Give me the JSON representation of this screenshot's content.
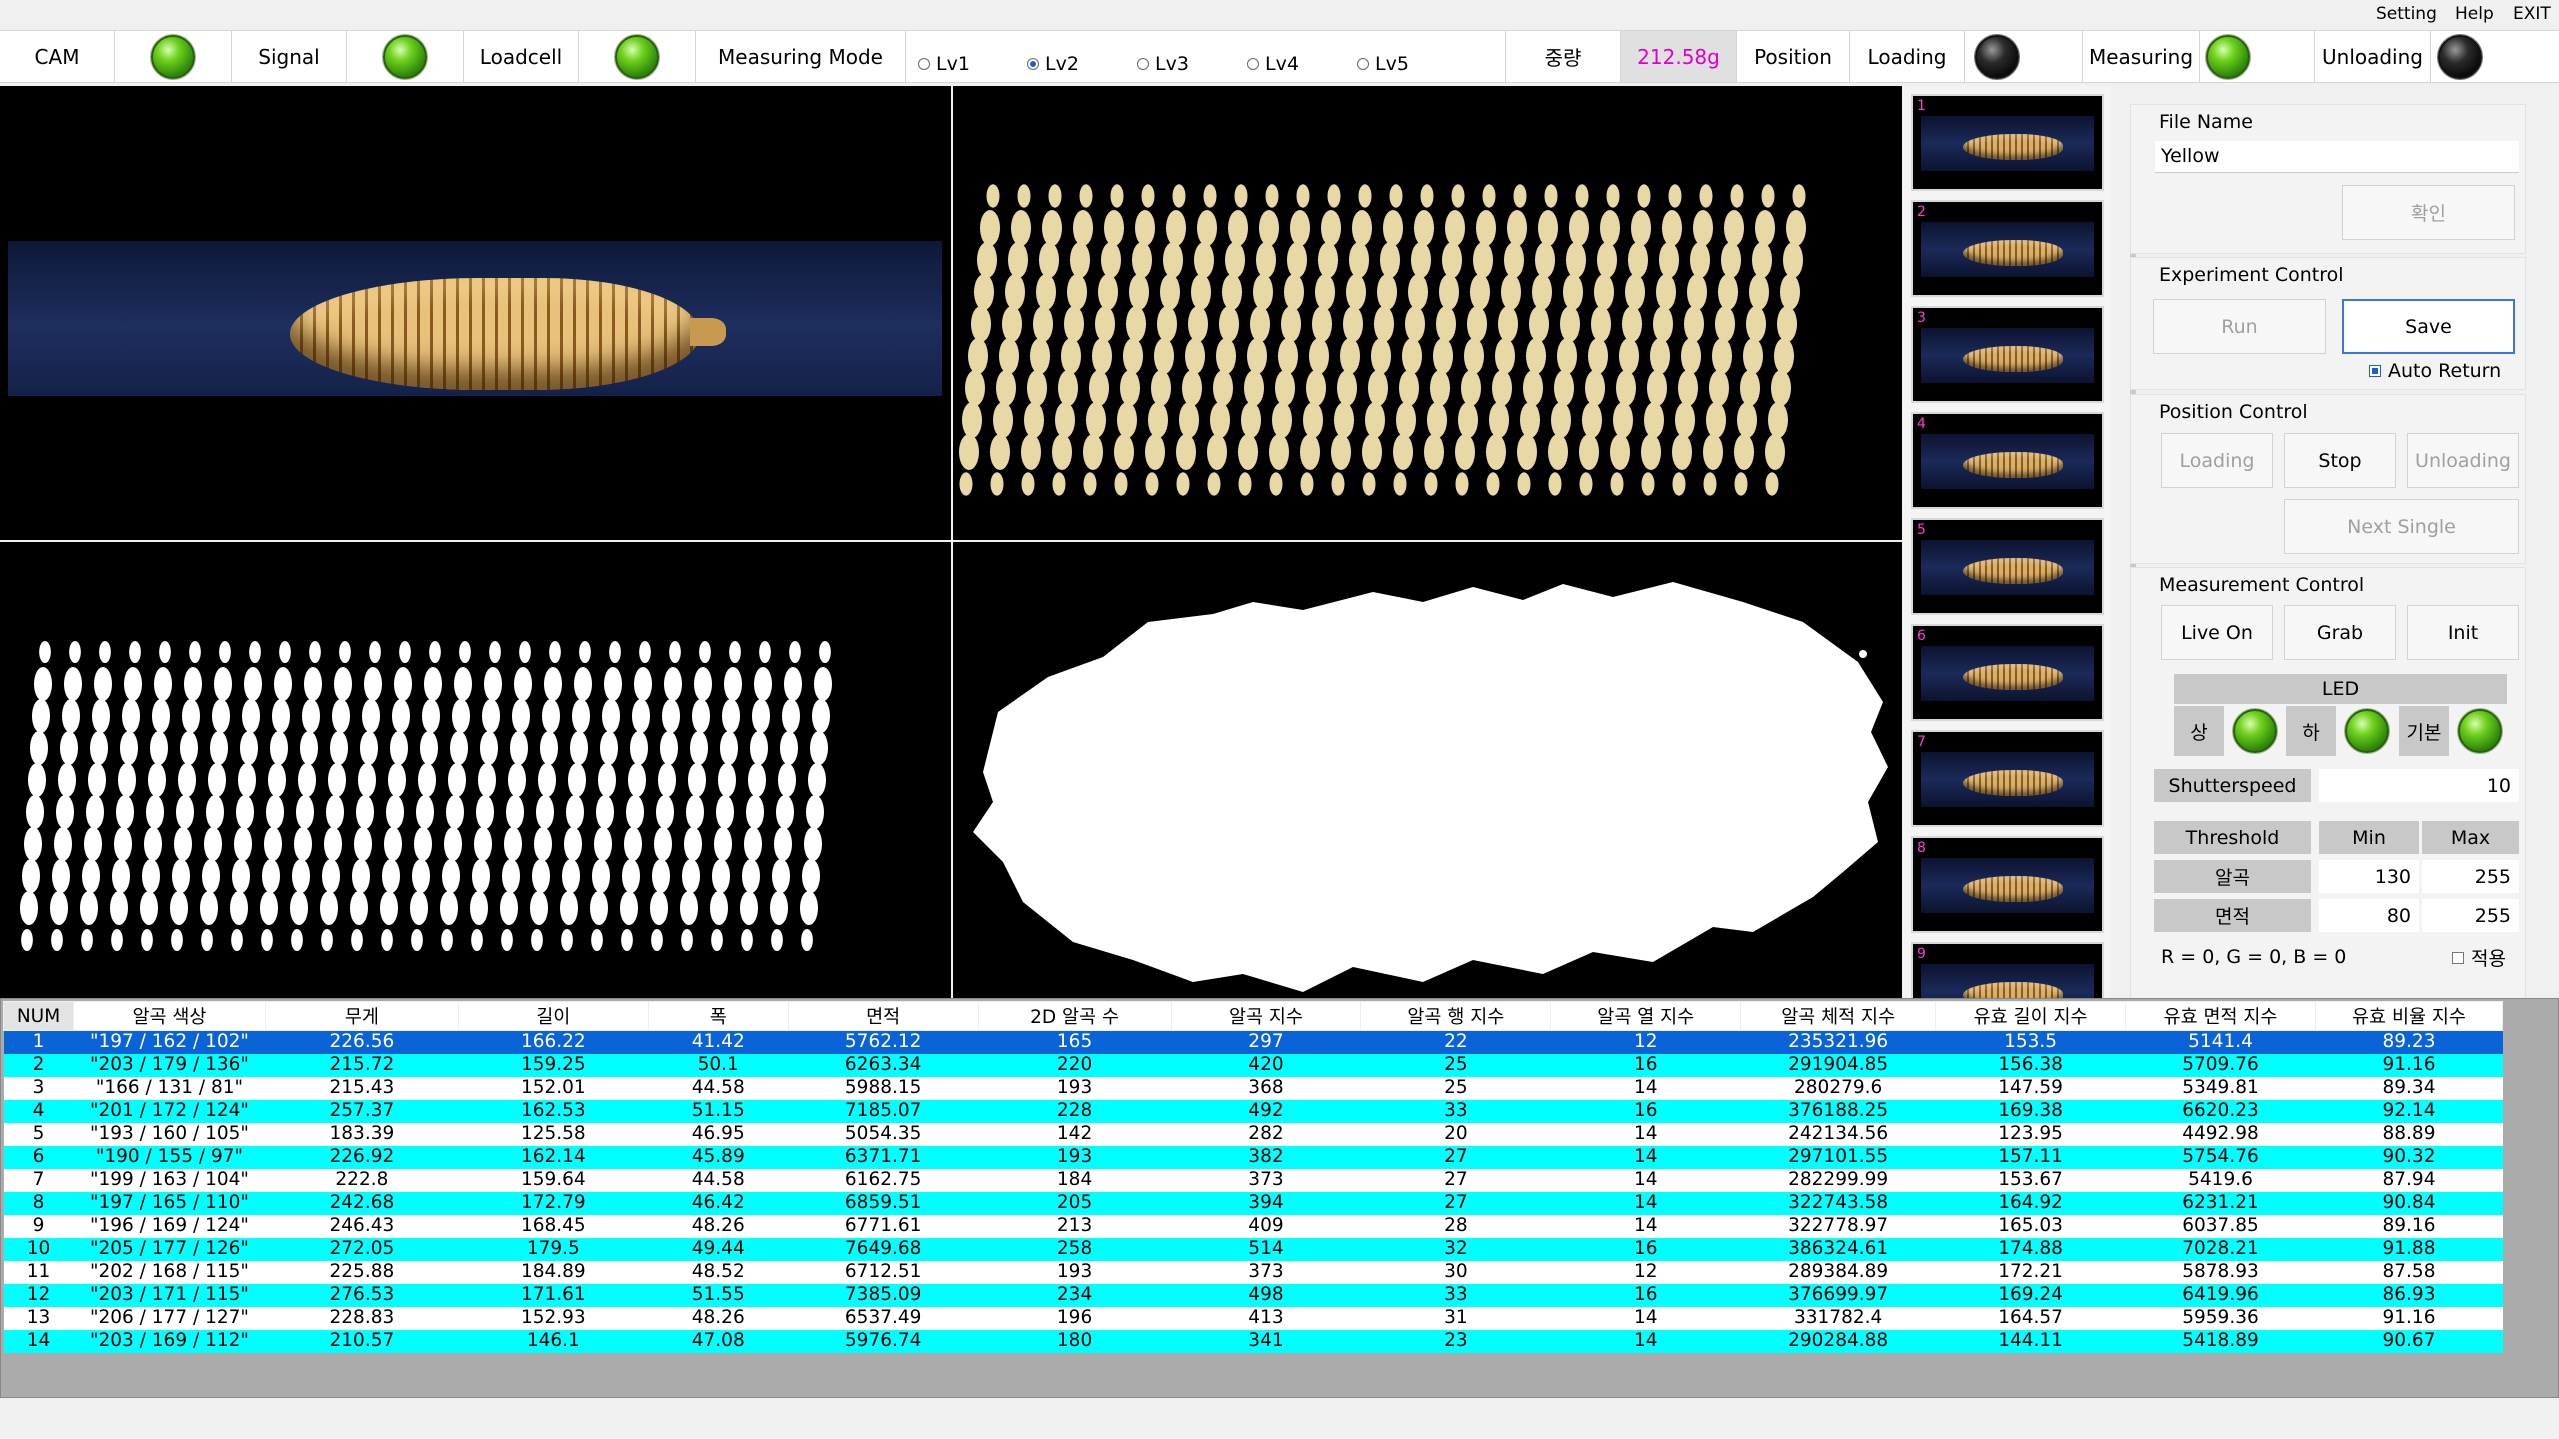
{
  "menu": [
    "Setting",
    "Help",
    "EXIT"
  ],
  "status": {
    "cam": "CAM",
    "signal": "Signal",
    "loadcell": "Loadcell",
    "measuring_mode": "Measuring Mode",
    "levels": [
      "Lv1",
      "Lv2",
      "Lv3",
      "Lv4",
      "Lv5"
    ],
    "selected_level": "Lv2",
    "weight_label": "중량",
    "weight_value": "212.58g",
    "position": "Position",
    "loading": "Loading",
    "measuring": "Measuring",
    "unloading": "Unloading",
    "leds": {
      "cam": "green",
      "signal": "green",
      "loadcell": "green",
      "loading": "off",
      "measuring": "green",
      "unloading": "off"
    }
  },
  "thumbnails": [
    "1",
    "2",
    "3",
    "4",
    "5",
    "6",
    "7",
    "8",
    "9"
  ],
  "panel": {
    "file_name_label": "File Name",
    "file_name_value": "Yellow",
    "confirm": "확인",
    "experiment_control": "Experiment Control",
    "run": "Run",
    "save": "Save",
    "auto_return": "Auto Return",
    "position_control": "Position Control",
    "loading": "Loading",
    "stop": "Stop",
    "unloading": "Unloading",
    "next_single": "Next Single",
    "measurement_control": "Measurement Control",
    "live_on": "Live On",
    "grab": "Grab",
    "init": "Init",
    "led": "LED",
    "led_top": "상",
    "led_bottom": "하",
    "led_default": "기본",
    "shutterspeed_label": "Shutterspeed",
    "shutterspeed_value": "10",
    "threshold": "Threshold",
    "min": "Min",
    "max": "Max",
    "grain": "알곡",
    "grain_min": "130",
    "grain_max": "255",
    "area": "면적",
    "area_min": "80",
    "area_max": "255",
    "rgb": "R = 0, G = 0, B = 0",
    "apply": "적용"
  },
  "table": {
    "headers": [
      "NUM",
      "알곡 색상",
      "무게",
      "길이",
      "폭",
      "면적",
      "2D 알곡 수",
      "알곡 지수",
      "알곡 행 지수",
      "알곡 열 지수",
      "알곡 체적 지수",
      "유효 길이 지수",
      "유효 면적 지수",
      "유효 비율 지수"
    ],
    "rows": [
      [
        "1",
        "\"197 / 162 / 102\"",
        "226.56",
        "166.22",
        "41.42",
        "5762.12",
        "165",
        "297",
        "22",
        "12",
        "235321.96",
        "153.5",
        "5141.4",
        "89.23"
      ],
      [
        "2",
        "\"203 / 179 / 136\"",
        "215.72",
        "159.25",
        "50.1",
        "6263.34",
        "220",
        "420",
        "25",
        "16",
        "291904.85",
        "156.38",
        "5709.76",
        "91.16"
      ],
      [
        "3",
        "\"166 / 131 / 81\"",
        "215.43",
        "152.01",
        "44.58",
        "5988.15",
        "193",
        "368",
        "25",
        "14",
        "280279.6",
        "147.59",
        "5349.81",
        "89.34"
      ],
      [
        "4",
        "\"201 / 172 / 124\"",
        "257.37",
        "162.53",
        "51.15",
        "7185.07",
        "228",
        "492",
        "33",
        "16",
        "376188.25",
        "169.38",
        "6620.23",
        "92.14"
      ],
      [
        "5",
        "\"193 / 160 / 105\"",
        "183.39",
        "125.58",
        "46.95",
        "5054.35",
        "142",
        "282",
        "20",
        "14",
        "242134.56",
        "123.95",
        "4492.98",
        "88.89"
      ],
      [
        "6",
        "\"190 / 155 / 97\"",
        "226.92",
        "162.14",
        "45.89",
        "6371.71",
        "193",
        "382",
        "27",
        "14",
        "297101.55",
        "157.11",
        "5754.76",
        "90.32"
      ],
      [
        "7",
        "\"199 / 163 / 104\"",
        "222.8",
        "159.64",
        "44.58",
        "6162.75",
        "184",
        "373",
        "27",
        "14",
        "282299.99",
        "153.67",
        "5419.6",
        "87.94"
      ],
      [
        "8",
        "\"197 / 165 / 110\"",
        "242.68",
        "172.79",
        "46.42",
        "6859.51",
        "205",
        "394",
        "27",
        "14",
        "322743.58",
        "164.92",
        "6231.21",
        "90.84"
      ],
      [
        "9",
        "\"196 / 169 / 124\"",
        "246.43",
        "168.45",
        "48.26",
        "6771.61",
        "213",
        "409",
        "28",
        "14",
        "322778.97",
        "165.03",
        "6037.85",
        "89.16"
      ],
      [
        "10",
        "\"205 / 177 / 126\"",
        "272.05",
        "179.5",
        "49.44",
        "7649.68",
        "258",
        "514",
        "32",
        "16",
        "386324.61",
        "174.88",
        "7028.21",
        "91.88"
      ],
      [
        "11",
        "\"202 / 168 / 115\"",
        "225.88",
        "184.89",
        "48.52",
        "6712.51",
        "193",
        "373",
        "30",
        "12",
        "289384.89",
        "172.21",
        "5878.93",
        "87.58"
      ],
      [
        "12",
        "\"203 / 171 / 115\"",
        "276.53",
        "171.61",
        "51.55",
        "7385.09",
        "234",
        "498",
        "33",
        "16",
        "376699.97",
        "169.24",
        "6419.96",
        "86.93"
      ],
      [
        "13",
        "\"206 / 177 / 127\"",
        "228.83",
        "152.93",
        "48.26",
        "6537.49",
        "196",
        "413",
        "31",
        "14",
        "331782.4",
        "164.57",
        "5959.36",
        "91.16"
      ],
      [
        "14",
        "\"203 / 169 / 112\"",
        "210.57",
        "146.1",
        "47.08",
        "5976.74",
        "180",
        "341",
        "23",
        "14",
        "290284.88",
        "144.11",
        "5418.89",
        "90.67"
      ]
    ]
  }
}
